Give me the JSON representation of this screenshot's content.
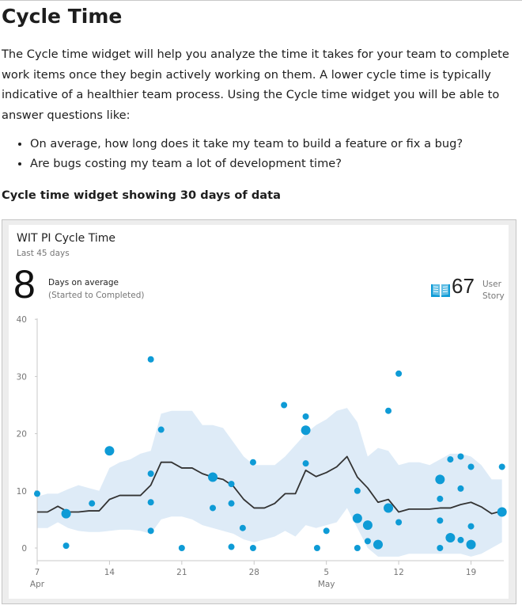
{
  "doc": {
    "title": "Cycle Time",
    "intro": "The Cycle time widget will help you analyze the time it takes for your team to complete work items once they begin actively working on them. A lower cycle time is typically indicative of a healthier team process. Using the Cycle time widget you will be able to answer questions like:",
    "bullets": [
      "On average, how long does it take my team to build a feature or fix a bug?",
      "Are bugs costing my team a lot of development time?"
    ],
    "caption": "Cycle time widget showing 30 days of data"
  },
  "widget": {
    "title": "WIT PI Cycle Time",
    "subtitle": "Last 45 days",
    "average_value": "8",
    "average_label": "Days on average",
    "average_sublabel": "(Started to Completed)",
    "item_count": "67",
    "item_type_line1": "User",
    "item_type_line2": "Story",
    "icon": "book-icon",
    "accent_color": "#0e9bd6"
  },
  "chart_data": {
    "type": "scatter",
    "x_unit": "day",
    "y_axis": {
      "range": [
        0,
        40
      ],
      "ticks": [
        0,
        10,
        20,
        30,
        40
      ]
    },
    "x_axis": {
      "range": [
        "2016-04-07",
        "2016-04-21"
      ],
      "ticks": [
        {
          "date": "Apr 7",
          "day": 7,
          "label": "7",
          "sublabel": "Apr"
        },
        {
          "date": "Apr 14",
          "day": 14,
          "label": "14",
          "sublabel": ""
        },
        {
          "date": "Apr 21",
          "day": 21,
          "label": "21",
          "sublabel": ""
        },
        {
          "date": "Apr 28",
          "day": 28,
          "label": "28",
          "sublabel": ""
        },
        {
          "date": "May 5",
          "day": 35,
          "label": "5",
          "sublabel": "May"
        },
        {
          "date": "May 12",
          "day": 42,
          "label": "12",
          "sublabel": ""
        },
        {
          "date": "May 19",
          "day": 49,
          "label": "19",
          "sublabel": ""
        }
      ]
    },
    "colors": {
      "points": "#0e9bd6",
      "line": "#333333",
      "band": "#deebf7"
    },
    "points": [
      {
        "x": 7.0,
        "y": 9.5,
        "r": 4
      },
      {
        "x": 9.8,
        "y": 6.0,
        "r": 6
      },
      {
        "x": 9.8,
        "y": 0.4,
        "r": 4
      },
      {
        "x": 12.3,
        "y": 7.8,
        "r": 4
      },
      {
        "x": 14.0,
        "y": 17.0,
        "r": 6
      },
      {
        "x": 18.0,
        "y": 33.0,
        "r": 4
      },
      {
        "x": 18.0,
        "y": 13.0,
        "r": 4
      },
      {
        "x": 18.0,
        "y": 8.0,
        "r": 4
      },
      {
        "x": 18.0,
        "y": 3.0,
        "r": 4
      },
      {
        "x": 19.0,
        "y": 20.7,
        "r": 4
      },
      {
        "x": 21.0,
        "y": 0.0,
        "r": 4
      },
      {
        "x": 24.0,
        "y": 12.4,
        "r": 6
      },
      {
        "x": 24.0,
        "y": 7.0,
        "r": 4
      },
      {
        "x": 25.8,
        "y": 11.2,
        "r": 4
      },
      {
        "x": 25.8,
        "y": 7.8,
        "r": 4
      },
      {
        "x": 25.8,
        "y": 0.2,
        "r": 4
      },
      {
        "x": 26.9,
        "y": 3.5,
        "r": 4
      },
      {
        "x": 27.9,
        "y": 15.0,
        "r": 4
      },
      {
        "x": 27.9,
        "y": 0.0,
        "r": 4
      },
      {
        "x": 30.9,
        "y": 25.0,
        "r": 4
      },
      {
        "x": 33.0,
        "y": 23.0,
        "r": 4
      },
      {
        "x": 33.0,
        "y": 20.6,
        "r": 6
      },
      {
        "x": 33.0,
        "y": 14.8,
        "r": 4
      },
      {
        "x": 34.1,
        "y": 0.0,
        "r": 4
      },
      {
        "x": 35.0,
        "y": 3.0,
        "r": 4
      },
      {
        "x": 38.0,
        "y": 10.0,
        "r": 4
      },
      {
        "x": 38.0,
        "y": 5.2,
        "r": 6
      },
      {
        "x": 38.0,
        "y": 0.0,
        "r": 4
      },
      {
        "x": 39.0,
        "y": 4.0,
        "r": 6
      },
      {
        "x": 39.0,
        "y": 1.2,
        "r": 4
      },
      {
        "x": 40.0,
        "y": 0.6,
        "r": 6
      },
      {
        "x": 41.0,
        "y": 24.0,
        "r": 4
      },
      {
        "x": 41.0,
        "y": 7.0,
        "r": 6
      },
      {
        "x": 42.0,
        "y": 30.5,
        "r": 4
      },
      {
        "x": 42.0,
        "y": 4.5,
        "r": 4
      },
      {
        "x": 46.0,
        "y": 12.0,
        "r": 6
      },
      {
        "x": 46.0,
        "y": 8.6,
        "r": 4
      },
      {
        "x": 46.0,
        "y": 4.8,
        "r": 4
      },
      {
        "x": 46.0,
        "y": 0.0,
        "r": 4
      },
      {
        "x": 47.0,
        "y": 15.5,
        "r": 4
      },
      {
        "x": 47.0,
        "y": 1.8,
        "r": 6
      },
      {
        "x": 48.0,
        "y": 16.0,
        "r": 4
      },
      {
        "x": 48.0,
        "y": 10.4,
        "r": 4
      },
      {
        "x": 48.0,
        "y": 1.4,
        "r": 4
      },
      {
        "x": 49.0,
        "y": 14.2,
        "r": 4
      },
      {
        "x": 49.0,
        "y": 3.8,
        "r": 4
      },
      {
        "x": 49.0,
        "y": 0.6,
        "r": 6
      },
      {
        "x": 52.0,
        "y": 14.2,
        "r": 4
      },
      {
        "x": 52.0,
        "y": 6.3,
        "r": 6
      }
    ],
    "moving_average": [
      [
        7,
        6.3
      ],
      [
        8,
        6.3
      ],
      [
        9,
        7.3
      ],
      [
        10,
        6.3
      ],
      [
        11,
        6.3
      ],
      [
        12,
        6.5
      ],
      [
        13,
        6.5
      ],
      [
        14,
        8.5
      ],
      [
        15,
        9.2
      ],
      [
        16,
        9.2
      ],
      [
        17,
        9.2
      ],
      [
        18,
        11.0
      ],
      [
        19,
        15.0
      ],
      [
        20,
        15.0
      ],
      [
        21,
        14.0
      ],
      [
        22,
        14.0
      ],
      [
        23,
        13.0
      ],
      [
        24,
        12.4
      ],
      [
        25,
        12.0
      ],
      [
        26,
        10.8
      ],
      [
        27,
        8.5
      ],
      [
        28,
        7.0
      ],
      [
        29,
        7.0
      ],
      [
        30,
        7.8
      ],
      [
        31,
        9.5
      ],
      [
        32,
        9.5
      ],
      [
        33,
        13.6
      ],
      [
        34,
        12.5
      ],
      [
        35,
        13.2
      ],
      [
        36,
        14.2
      ],
      [
        37,
        16.0
      ],
      [
        38,
        12.4
      ],
      [
        39,
        10.5
      ],
      [
        40,
        8.0
      ],
      [
        41,
        8.5
      ],
      [
        42,
        6.3
      ],
      [
        43,
        6.8
      ],
      [
        44,
        6.8
      ],
      [
        45,
        6.8
      ],
      [
        46,
        7.0
      ],
      [
        47,
        7.0
      ],
      [
        48,
        7.6
      ],
      [
        49,
        8.0
      ],
      [
        50,
        7.2
      ],
      [
        51,
        6.0
      ],
      [
        52,
        6.5
      ]
    ],
    "band_upper": [
      [
        7,
        9.0
      ],
      [
        8,
        9.5
      ],
      [
        9,
        9.5
      ],
      [
        10,
        10.3
      ],
      [
        11,
        11.0
      ],
      [
        12,
        10.5
      ],
      [
        13,
        10.0
      ],
      [
        14,
        14.0
      ],
      [
        15,
        15.0
      ],
      [
        16,
        15.5
      ],
      [
        17,
        16.5
      ],
      [
        18,
        17.0
      ],
      [
        19,
        23.5
      ],
      [
        20,
        24.0
      ],
      [
        21,
        24.0
      ],
      [
        22,
        24.0
      ],
      [
        23,
        21.5
      ],
      [
        24,
        21.5
      ],
      [
        25,
        21.0
      ],
      [
        26,
        18.5
      ],
      [
        27,
        16.0
      ],
      [
        28,
        14.5
      ],
      [
        29,
        14.5
      ],
      [
        30,
        14.5
      ],
      [
        31,
        16.0
      ],
      [
        32,
        18.0
      ],
      [
        33,
        20.0
      ],
      [
        34,
        21.5
      ],
      [
        35,
        22.5
      ],
      [
        36,
        24.0
      ],
      [
        37,
        24.5
      ],
      [
        38,
        22.0
      ],
      [
        39,
        16.0
      ],
      [
        40,
        17.5
      ],
      [
        41,
        17.0
      ],
      [
        42,
        14.5
      ],
      [
        43,
        15.0
      ],
      [
        44,
        15.0
      ],
      [
        45,
        14.5
      ],
      [
        46,
        15.5
      ],
      [
        47,
        16.5
      ],
      [
        48,
        16.5
      ],
      [
        49,
        16.0
      ],
      [
        50,
        14.5
      ],
      [
        51,
        12.0
      ],
      [
        52,
        12.0
      ]
    ],
    "band_lower": [
      [
        7,
        3.5
      ],
      [
        8,
        3.5
      ],
      [
        9,
        4.5
      ],
      [
        10,
        3.5
      ],
      [
        11,
        3.0
      ],
      [
        12,
        2.8
      ],
      [
        13,
        2.8
      ],
      [
        14,
        3.0
      ],
      [
        15,
        3.2
      ],
      [
        16,
        3.2
      ],
      [
        17,
        3.0
      ],
      [
        18,
        2.5
      ],
      [
        19,
        5.0
      ],
      [
        20,
        5.5
      ],
      [
        21,
        5.5
      ],
      [
        22,
        5.0
      ],
      [
        23,
        4.0
      ],
      [
        24,
        3.5
      ],
      [
        25,
        3.0
      ],
      [
        26,
        2.5
      ],
      [
        27,
        1.5
      ],
      [
        28,
        1.0
      ],
      [
        29,
        1.5
      ],
      [
        30,
        2.0
      ],
      [
        31,
        3.0
      ],
      [
        32,
        2.0
      ],
      [
        33,
        4.0
      ],
      [
        34,
        3.5
      ],
      [
        35,
        4.0
      ],
      [
        36,
        4.5
      ],
      [
        37,
        7.0
      ],
      [
        38,
        3.5
      ],
      [
        39,
        0.0
      ],
      [
        40,
        -1.5
      ],
      [
        41,
        -1.5
      ],
      [
        42,
        -1.5
      ],
      [
        43,
        -1.0
      ],
      [
        44,
        -1.0
      ],
      [
        45,
        -1.0
      ],
      [
        46,
        -1.0
      ],
      [
        47,
        -1.0
      ],
      [
        48,
        -1.0
      ],
      [
        49,
        -1.5
      ],
      [
        50,
        -1.0
      ],
      [
        51,
        0.0
      ],
      [
        52,
        1.0
      ]
    ]
  }
}
